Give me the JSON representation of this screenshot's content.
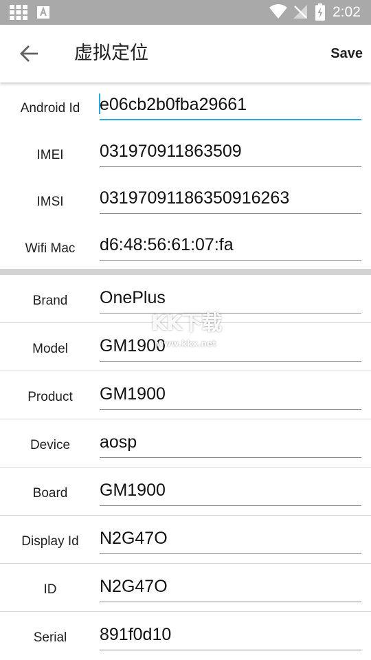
{
  "status_bar": {
    "time": "2:02",
    "icons": [
      "grid-icon",
      "a-badge-icon",
      "wifi-icon",
      "no-signal-icon",
      "battery-charging-icon"
    ]
  },
  "app_bar": {
    "back_icon": "arrow-left-icon",
    "title": "虚拟定位",
    "save_label": "Save"
  },
  "device_ids": [
    {
      "label": "Android Id",
      "value": "e06cb2b0fba29661",
      "focused": true
    },
    {
      "label": "IMEI",
      "value": "031970911863509"
    },
    {
      "label": "IMSI",
      "value": "03197091186350916263"
    },
    {
      "label": "Wifi Mac",
      "value": "d6:48:56:61:07:fa"
    }
  ],
  "build_props": [
    {
      "label": "Brand",
      "value": "OnePlus"
    },
    {
      "label": "Model",
      "value": "GM1900"
    },
    {
      "label": "Product",
      "value": "GM1900"
    },
    {
      "label": "Device",
      "value": "aosp"
    },
    {
      "label": "Board",
      "value": "GM1900"
    },
    {
      "label": "Display Id",
      "value": "N2G47O"
    },
    {
      "label": "ID",
      "value": "N2G47O"
    },
    {
      "label": "Serial",
      "value": "891f0d10"
    }
  ],
  "watermark": {
    "title": "KK下载",
    "url": "www.kkx.net"
  },
  "colors": {
    "status_bar": "#a9a9a9",
    "accent": "#29a9de",
    "divider": "#d3d3d3"
  }
}
